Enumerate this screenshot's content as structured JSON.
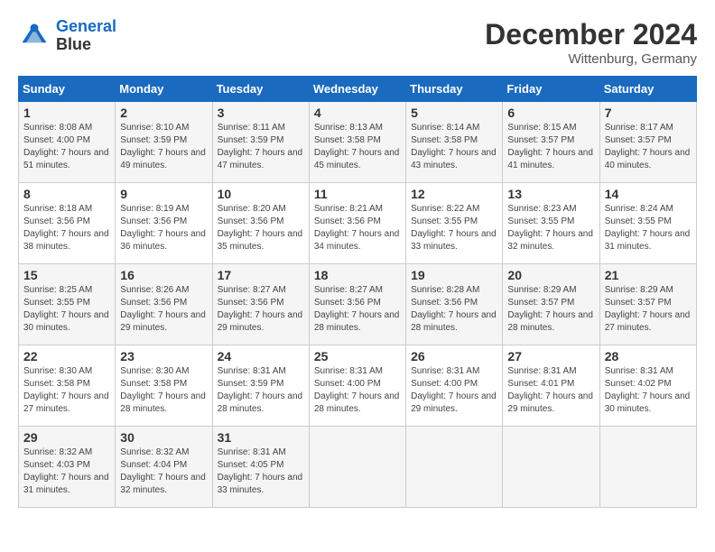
{
  "header": {
    "logo_line1": "General",
    "logo_line2": "Blue",
    "month": "December 2024",
    "location": "Wittenburg, Germany"
  },
  "weekdays": [
    "Sunday",
    "Monday",
    "Tuesday",
    "Wednesday",
    "Thursday",
    "Friday",
    "Saturday"
  ],
  "weeks": [
    [
      {
        "day": "1",
        "sunrise": "Sunrise: 8:08 AM",
        "sunset": "Sunset: 4:00 PM",
        "daylight": "Daylight: 7 hours and 51 minutes."
      },
      {
        "day": "2",
        "sunrise": "Sunrise: 8:10 AM",
        "sunset": "Sunset: 3:59 PM",
        "daylight": "Daylight: 7 hours and 49 minutes."
      },
      {
        "day": "3",
        "sunrise": "Sunrise: 8:11 AM",
        "sunset": "Sunset: 3:59 PM",
        "daylight": "Daylight: 7 hours and 47 minutes."
      },
      {
        "day": "4",
        "sunrise": "Sunrise: 8:13 AM",
        "sunset": "Sunset: 3:58 PM",
        "daylight": "Daylight: 7 hours and 45 minutes."
      },
      {
        "day": "5",
        "sunrise": "Sunrise: 8:14 AM",
        "sunset": "Sunset: 3:58 PM",
        "daylight": "Daylight: 7 hours and 43 minutes."
      },
      {
        "day": "6",
        "sunrise": "Sunrise: 8:15 AM",
        "sunset": "Sunset: 3:57 PM",
        "daylight": "Daylight: 7 hours and 41 minutes."
      },
      {
        "day": "7",
        "sunrise": "Sunrise: 8:17 AM",
        "sunset": "Sunset: 3:57 PM",
        "daylight": "Daylight: 7 hours and 40 minutes."
      }
    ],
    [
      {
        "day": "8",
        "sunrise": "Sunrise: 8:18 AM",
        "sunset": "Sunset: 3:56 PM",
        "daylight": "Daylight: 7 hours and 38 minutes."
      },
      {
        "day": "9",
        "sunrise": "Sunrise: 8:19 AM",
        "sunset": "Sunset: 3:56 PM",
        "daylight": "Daylight: 7 hours and 36 minutes."
      },
      {
        "day": "10",
        "sunrise": "Sunrise: 8:20 AM",
        "sunset": "Sunset: 3:56 PM",
        "daylight": "Daylight: 7 hours and 35 minutes."
      },
      {
        "day": "11",
        "sunrise": "Sunrise: 8:21 AM",
        "sunset": "Sunset: 3:56 PM",
        "daylight": "Daylight: 7 hours and 34 minutes."
      },
      {
        "day": "12",
        "sunrise": "Sunrise: 8:22 AM",
        "sunset": "Sunset: 3:55 PM",
        "daylight": "Daylight: 7 hours and 33 minutes."
      },
      {
        "day": "13",
        "sunrise": "Sunrise: 8:23 AM",
        "sunset": "Sunset: 3:55 PM",
        "daylight": "Daylight: 7 hours and 32 minutes."
      },
      {
        "day": "14",
        "sunrise": "Sunrise: 8:24 AM",
        "sunset": "Sunset: 3:55 PM",
        "daylight": "Daylight: 7 hours and 31 minutes."
      }
    ],
    [
      {
        "day": "15",
        "sunrise": "Sunrise: 8:25 AM",
        "sunset": "Sunset: 3:55 PM",
        "daylight": "Daylight: 7 hours and 30 minutes."
      },
      {
        "day": "16",
        "sunrise": "Sunrise: 8:26 AM",
        "sunset": "Sunset: 3:56 PM",
        "daylight": "Daylight: 7 hours and 29 minutes."
      },
      {
        "day": "17",
        "sunrise": "Sunrise: 8:27 AM",
        "sunset": "Sunset: 3:56 PM",
        "daylight": "Daylight: 7 hours and 29 minutes."
      },
      {
        "day": "18",
        "sunrise": "Sunrise: 8:27 AM",
        "sunset": "Sunset: 3:56 PM",
        "daylight": "Daylight: 7 hours and 28 minutes."
      },
      {
        "day": "19",
        "sunrise": "Sunrise: 8:28 AM",
        "sunset": "Sunset: 3:56 PM",
        "daylight": "Daylight: 7 hours and 28 minutes."
      },
      {
        "day": "20",
        "sunrise": "Sunrise: 8:29 AM",
        "sunset": "Sunset: 3:57 PM",
        "daylight": "Daylight: 7 hours and 28 minutes."
      },
      {
        "day": "21",
        "sunrise": "Sunrise: 8:29 AM",
        "sunset": "Sunset: 3:57 PM",
        "daylight": "Daylight: 7 hours and 27 minutes."
      }
    ],
    [
      {
        "day": "22",
        "sunrise": "Sunrise: 8:30 AM",
        "sunset": "Sunset: 3:58 PM",
        "daylight": "Daylight: 7 hours and 27 minutes."
      },
      {
        "day": "23",
        "sunrise": "Sunrise: 8:30 AM",
        "sunset": "Sunset: 3:58 PM",
        "daylight": "Daylight: 7 hours and 28 minutes."
      },
      {
        "day": "24",
        "sunrise": "Sunrise: 8:31 AM",
        "sunset": "Sunset: 3:59 PM",
        "daylight": "Daylight: 7 hours and 28 minutes."
      },
      {
        "day": "25",
        "sunrise": "Sunrise: 8:31 AM",
        "sunset": "Sunset: 4:00 PM",
        "daylight": "Daylight: 7 hours and 28 minutes."
      },
      {
        "day": "26",
        "sunrise": "Sunrise: 8:31 AM",
        "sunset": "Sunset: 4:00 PM",
        "daylight": "Daylight: 7 hours and 29 minutes."
      },
      {
        "day": "27",
        "sunrise": "Sunrise: 8:31 AM",
        "sunset": "Sunset: 4:01 PM",
        "daylight": "Daylight: 7 hours and 29 minutes."
      },
      {
        "day": "28",
        "sunrise": "Sunrise: 8:31 AM",
        "sunset": "Sunset: 4:02 PM",
        "daylight": "Daylight: 7 hours and 30 minutes."
      }
    ],
    [
      {
        "day": "29",
        "sunrise": "Sunrise: 8:32 AM",
        "sunset": "Sunset: 4:03 PM",
        "daylight": "Daylight: 7 hours and 31 minutes."
      },
      {
        "day": "30",
        "sunrise": "Sunrise: 8:32 AM",
        "sunset": "Sunset: 4:04 PM",
        "daylight": "Daylight: 7 hours and 32 minutes."
      },
      {
        "day": "31",
        "sunrise": "Sunrise: 8:31 AM",
        "sunset": "Sunset: 4:05 PM",
        "daylight": "Daylight: 7 hours and 33 minutes."
      },
      null,
      null,
      null,
      null
    ]
  ]
}
